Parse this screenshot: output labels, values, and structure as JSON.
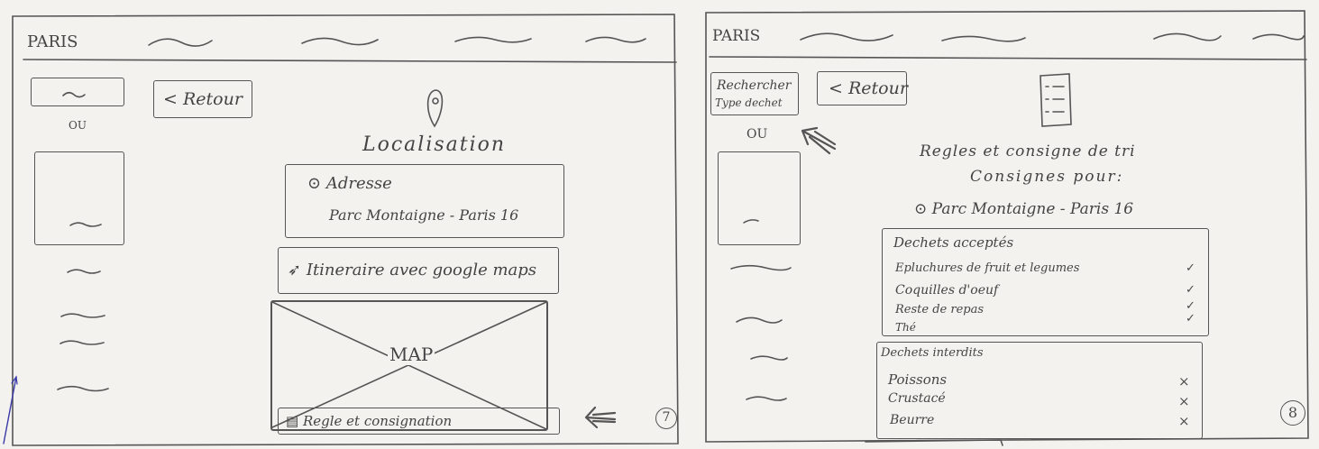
{
  "screens": [
    {
      "app_title": "PARIS",
      "back_label": "< Retour",
      "or_label": "OU",
      "page_title": "Localisation",
      "address": {
        "label": "Adresse",
        "value": "Parc Montaigne - Paris 16"
      },
      "itinerary_label": "Itineraire avec google maps",
      "map_label": "MAP",
      "rules_label": "Regle et consignation",
      "page_number": "7"
    },
    {
      "app_title": "PARIS",
      "search_label_line1": "Rechercher",
      "search_label_line2": "Type dechet",
      "back_label": "< Retour",
      "or_label": "OU",
      "title_line1": "Regles et consigne de tri",
      "title_line2": "Consignes pour:",
      "location": "Parc Montaigne - Paris 16",
      "accepted": {
        "header": "Dechets acceptés",
        "items": [
          "Epluchures de fruit et legumes",
          "Coquilles d'oeuf",
          "Reste de repas",
          "Thé"
        ]
      },
      "forbidden": {
        "header": "Dechets interdits",
        "items": [
          "Poissons",
          "Crustacé",
          "Beurre"
        ]
      },
      "page_number": "8"
    }
  ]
}
